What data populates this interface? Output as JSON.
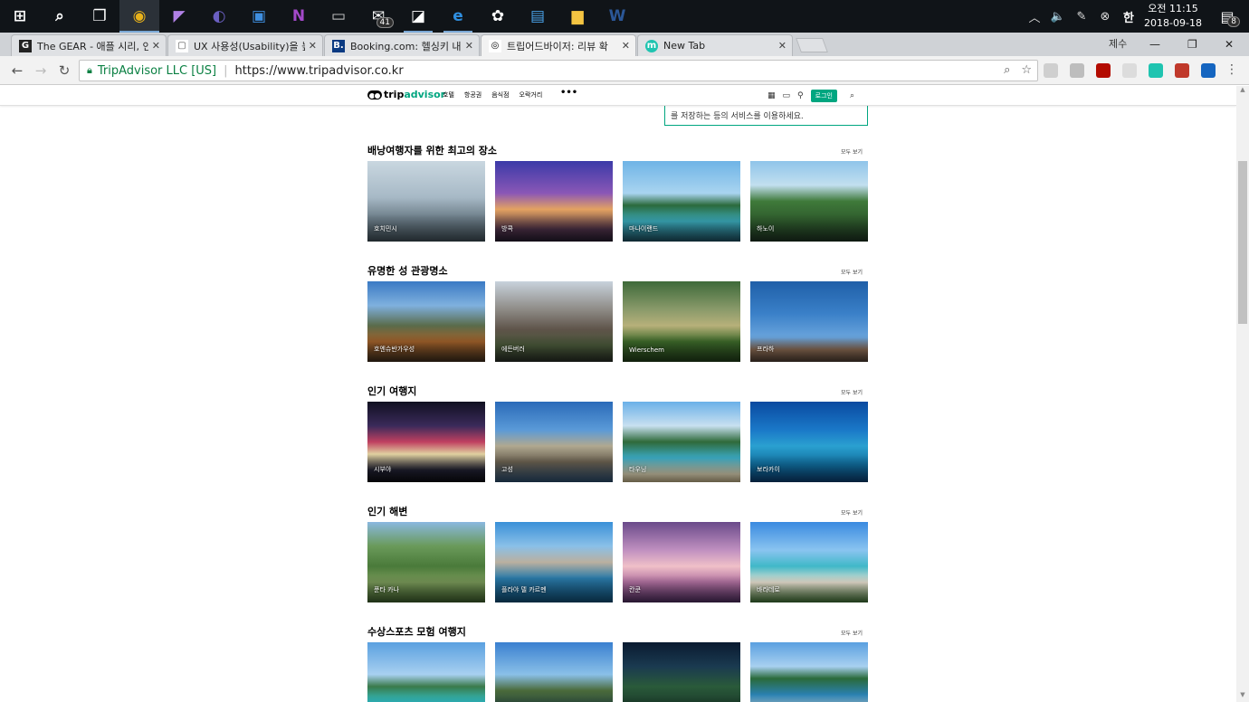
{
  "taskbar": {
    "icons": [
      {
        "name": "windows-start-icon",
        "glyph": "⊞",
        "color": "#ffffff"
      },
      {
        "name": "search-icon",
        "glyph": "⌕",
        "color": "#ffffff"
      },
      {
        "name": "task-view-icon",
        "glyph": "❐",
        "color": "#ffffff"
      },
      {
        "name": "chrome-icon",
        "glyph": "◉",
        "color": "#e8b21b",
        "active": true
      },
      {
        "name": "visual-studio-icon",
        "glyph": "◤",
        "color": "#b181e6"
      },
      {
        "name": "eclipse-icon",
        "glyph": "◐",
        "color": "#6a5fc1"
      },
      {
        "name": "network-icon",
        "glyph": "▣",
        "color": "#3f8fe0"
      },
      {
        "name": "onenote-icon",
        "glyph": "N",
        "color": "#a349c9"
      },
      {
        "name": "terminal-icon",
        "glyph": "▭",
        "color": "#cccccc"
      },
      {
        "name": "mail-icon",
        "glyph": "✉",
        "color": "#ffffff",
        "badge": "41"
      },
      {
        "name": "sticky-notes-icon",
        "glyph": "◪",
        "color": "#ffffff",
        "running": true
      },
      {
        "name": "edge-icon",
        "glyph": "e",
        "color": "#2f8fe0",
        "running": true
      },
      {
        "name": "paint-icon",
        "glyph": "✿",
        "color": "#ffffff"
      },
      {
        "name": "app-window-icon",
        "glyph": "▤",
        "color": "#4aa3ea"
      },
      {
        "name": "file-explorer-icon",
        "glyph": "▆",
        "color": "#f5c542"
      },
      {
        "name": "word-icon",
        "glyph": "W",
        "color": "#2b5797"
      }
    ],
    "tray": {
      "chevron": "︿",
      "volume": "🔈",
      "pen": "✎",
      "close_circle": "⊗",
      "ime": "한",
      "time": "오전 11:15",
      "date": "2018-09-18",
      "notification_count": "8"
    }
  },
  "browser": {
    "tabs": [
      {
        "title": "The GEAR - 애플 시리, 인",
        "favicon": "G",
        "favicon_bg": "#222222",
        "favicon_color": "#ffffff"
      },
      {
        "title": "UX 사용성(Usability)을 높",
        "favicon": "▢",
        "favicon_bg": "#ffffff",
        "favicon_color": "#555555"
      },
      {
        "title": "Booking.com: 헬싱키 내",
        "favicon": "B.",
        "favicon_bg": "#0a3a82",
        "favicon_color": "#ffffff"
      },
      {
        "title": "트립어드바이저: 리뷰 확",
        "favicon": "◎",
        "favicon_bg": "#ffffff",
        "favicon_color": "#000000",
        "active": true
      },
      {
        "title": "New Tab",
        "favicon": "m",
        "favicon_bg": "#1fc4b0",
        "favicon_color": "#ffffff"
      }
    ],
    "user_label": "제수",
    "window_controls": {
      "minimize": "—",
      "maximize": "❐",
      "close": "✕"
    },
    "nav": {
      "back": "←",
      "forward": "→",
      "reload": "↻"
    },
    "secure_label": "TripAdvisor LLC [US]",
    "url": "https://www.tripadvisor.co.kr",
    "omni_icons": {
      "zoom": "⌕",
      "star": "☆"
    },
    "menu": "⋮",
    "extensions": [
      {
        "name": "ext-icon",
        "color": "#cfcfcf"
      },
      {
        "name": "ext-icon",
        "color": "#bdbdbd"
      },
      {
        "name": "acrobat-icon",
        "color": "#b30b00"
      },
      {
        "name": "ext-icon",
        "color": "#dcdcdc"
      },
      {
        "name": "ext-icon",
        "color": "#1fc4b0"
      },
      {
        "name": "ext-icon",
        "color": "#c0392b"
      },
      {
        "name": "ext-icon",
        "color": "#1565c0"
      }
    ]
  },
  "site": {
    "logo_trip": "trip",
    "logo_advisor": "advisor",
    "nav": [
      "호텔",
      "항공권",
      "음식점",
      "오락거리"
    ],
    "more": "•••",
    "login": "로그인",
    "notice": "를 저장하는 등의 서비스를 이용하세요.",
    "see_all": "모두 보기",
    "sections": [
      {
        "title": "배낭여행자를 위한 최고의 장소",
        "cards": [
          {
            "label": "호치민시",
            "bg": "linear-gradient(180deg,#c9d7e0 0%,#a7b9c6 45%,#6e7f8a 70%,#3c4a52 100%)"
          },
          {
            "label": "방콕",
            "bg": "linear-gradient(180deg,#3b3aa8 0%,#8a57b6 40%,#e3a261 60%,#4a2f45 85%,#221a2a 100%)"
          },
          {
            "label": "마나이랜드",
            "bg": "linear-gradient(180deg,#6fb4e6 0%,#a9d4f0 40%,#2b6a3c 55%,#3aa8b8 75%,#1b4a5a 100%)"
          },
          {
            "label": "하노이",
            "bg": "linear-gradient(180deg,#8fc4ea 0%,#c2dfef 30%,#3f7a3a 50%,#2e5a2c 75%,#1a2e1f 100%)"
          }
        ]
      },
      {
        "title": "유명한 성 관광명소",
        "cards": [
          {
            "label": "호엔슈반가우성",
            "bg": "linear-gradient(180deg,#3a7ac4 0%,#7fb0de 30%,#5a6b4a 55%,#a0602a 75%,#3a2a1a 100%)"
          },
          {
            "label": "에든버러",
            "bg": "linear-gradient(180deg,#c8d2dc 0%,#8e8b86 35%,#5e5349 60%,#4a5a3a 80%,#252a22 100%)"
          },
          {
            "label": "Wierschem",
            "bg": "linear-gradient(180deg,#3e6a3a 0%,#8a9a6a 35%,#b7b07a 55%,#3d6a2a 75%,#1f3a18 100%)"
          },
          {
            "label": "프라하",
            "bg": "linear-gradient(180deg,#1f5fa8 0%,#3a80c8 40%,#6aa4dc 70%,#8a6a52 85%,#4a3a30 100%)"
          }
        ]
      },
      {
        "title": "인기 여행지",
        "cards": [
          {
            "label": "시부야",
            "bg": "linear-gradient(180deg,#101020 0%,#3a2a5a 30%,#c04060 50%,#e0d0a0 65%,#202030 85%,#0a0a10 100%)"
          },
          {
            "label": "고성",
            "bg": "linear-gradient(180deg,#2a6ab8 0%,#5a9ad8 35%,#b0a890 55%,#6a6050 75%,#2a4a6a 100%)"
          },
          {
            "label": "타우닝",
            "bg": "linear-gradient(180deg,#6ab0e8 0%,#c8e0f0 30%,#2f6a3a 50%,#3aa8c0 70%,#d8cfb0 90%,#b8a880 100%)"
          },
          {
            "label": "보라카이",
            "bg": "linear-gradient(180deg,#0a4aa0 0%,#1a78c8 35%,#2aa0d0 55%,#0f6a9a 80%,#0a3a6a 100%)"
          }
        ]
      },
      {
        "title": "인기 해변",
        "cards": [
          {
            "label": "푼타 카나",
            "bg": "linear-gradient(180deg,#8ab8e0 0%,#6a9a5a 30%,#4a7a3a 55%,#7a9a5a 75%,#3a5a2a 100%)"
          },
          {
            "label": "플라야 델 카르멘",
            "bg": "linear-gradient(180deg,#3a90d8 0%,#8ac0e8 30%,#bab0a0 50%,#2a7aa8 70%,#0f4a70 100%)"
          },
          {
            "label": "칸쿤",
            "bg": "linear-gradient(180deg,#6a4a8a 0%,#c090c0 35%,#f0c0c8 55%,#b070a0 75%,#4a2a5a 100%)"
          },
          {
            "label": "바라데로",
            "bg": "linear-gradient(180deg,#3a8ae0 0%,#8ac4f0 35%,#40b8c8 55%,#e8e0d0 75%,#3a6a30 100%)"
          }
        ]
      },
      {
        "title": "수상스포츠 모험 여행지",
        "cards": [
          {
            "label": "",
            "bg": "linear-gradient(180deg,#5aa0e0 0%,#a8d0f0 40%,#3a7a4a 55%,#30c0c8 75%,#20a0b0 100%)"
          },
          {
            "label": "",
            "bg": "linear-gradient(180deg,#3a80d0 0%,#8ac0e8 40%,#4a6a3a 60%,#2a4a40 80%,#1a2a28 100%)"
          },
          {
            "label": "",
            "bg": "linear-gradient(180deg,#0a1a30 0%,#1a3a50 30%,#2a5a3a 55%,#1a3a2a 80%,#0a1a14 100%)"
          },
          {
            "label": "",
            "bg": "linear-gradient(180deg,#5aa0e0 0%,#a8d0f0 30%,#2a6a3a 45%,#2a80b0 65%,#c0e0f0 85%,#1a6a90 100%)"
          }
        ]
      }
    ]
  }
}
